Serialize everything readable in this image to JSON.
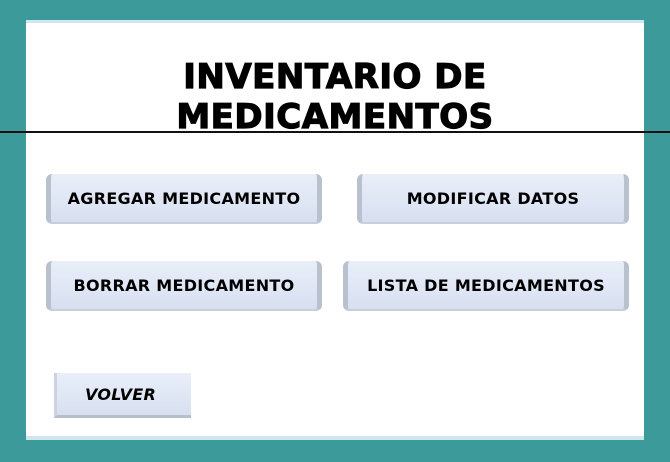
{
  "window": {
    "title": "INVENTARIO DE MEDICAMENTOS"
  },
  "buttons": {
    "agregar": "AGREGAR MEDICAMENTO",
    "modificar": "MODIFICAR DATOS",
    "borrar": "BORRAR MEDICAMENTO",
    "lista": "LISTA DE MEDICAMENTOS",
    "volver": "VOLVER"
  },
  "colors": {
    "background": "#3d9a9b",
    "panel": "#ffffff",
    "button": "#dfe6f4"
  }
}
